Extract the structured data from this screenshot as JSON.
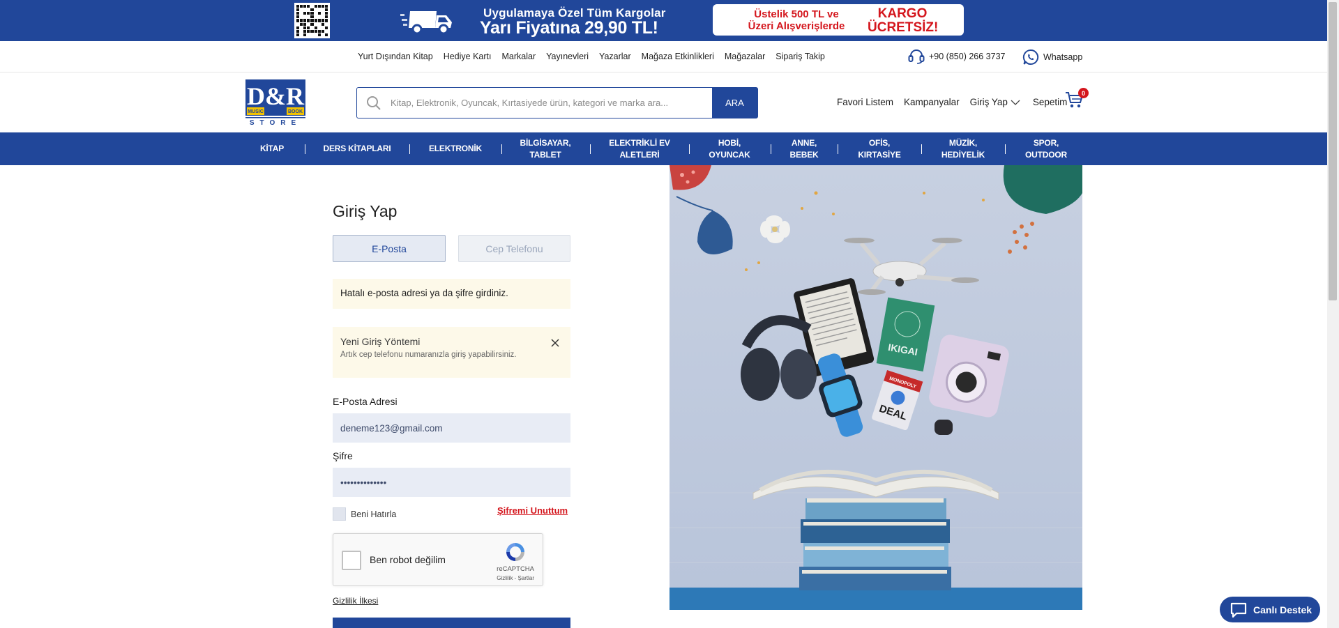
{
  "promo": {
    "line1": "Uygulamaya Özel Tüm Kargolar",
    "line2": "Yarı Fiyatına 29,90 TL!",
    "box_left_1": "Üstelik 500 TL ve",
    "box_left_2": "Üzeri Alışverişlerde",
    "box_right_1": "KARGO",
    "box_right_2": "ÜCRETSİZ!"
  },
  "util_nav": {
    "links": [
      "Yurt Dışından Kitap",
      "Hediye Kartı",
      "Markalar",
      "Yayınevleri",
      "Yazarlar",
      "Mağaza Etkinlikleri",
      "Mağazalar",
      "Sipariş Takip"
    ],
    "phone": "+90 (850) 266 3737",
    "whatsapp": "Whatsapp"
  },
  "logo": {
    "main": "D&R",
    "left_tag": "MUSIC",
    "right_tag": "BOOK",
    "store": "STORE"
  },
  "search": {
    "placeholder": "Kitap, Elektronik, Oyuncak, Kırtasiyede ürün, kategori ve marka ara...",
    "button": "ARA"
  },
  "header_links": {
    "favorites": "Favori Listem",
    "campaigns": "Kampanyalar",
    "login": "Giriş Yap",
    "cart": "Sepetim",
    "cart_count": "0"
  },
  "categories": [
    [
      "KİTAP"
    ],
    [
      "DERS KİTAPLARI"
    ],
    [
      "ELEKTRONİK"
    ],
    [
      "BİLGİSAYAR,",
      "TABLET"
    ],
    [
      "ELEKTRİKLİ EV",
      "ALETLERİ"
    ],
    [
      "HOBİ,",
      "OYUNCAK"
    ],
    [
      "ANNE,",
      "BEBEK"
    ],
    [
      "OFİS,",
      "KIRTASİYE"
    ],
    [
      "MÜZİK,",
      "HEDİYELİK"
    ],
    [
      "SPOR,",
      "OUTDOOR"
    ]
  ],
  "login": {
    "title": "Giriş Yap",
    "tab_email": "E-Posta",
    "tab_phone": "Cep Telefonu",
    "error": "Hatalı e-posta adresi ya da şifre girdiniz.",
    "info_title": "Yeni Giriş Yöntemi",
    "info_text": "Artık cep telefonu numaranızla giriş yapabilirsiniz.",
    "email_label": "E-Posta Adresi",
    "email_value": "deneme123@gmail.com",
    "password_label": "Şifre",
    "password_value": "••••••••••••••",
    "remember": "Beni Hatırla",
    "forgot": "Şifremi Unuttum",
    "recaptcha_label": "Ben robot değilim",
    "recaptcha_brand": "reCAPTCHA",
    "recaptcha_terms": "Gizlilik - Şartlar",
    "privacy": "Gizlilik İlkesi"
  },
  "hero": {
    "book_cover": "IKIGAI",
    "game_brand": "MONOPOLY",
    "game_title": "DEAL"
  },
  "chat": {
    "label": "Canlı Destek"
  },
  "colors": {
    "brand_blue": "#21479a",
    "accent_red": "#d4161d",
    "alert_bg": "#fdf9e9",
    "field_bg": "#e8ecf5"
  }
}
